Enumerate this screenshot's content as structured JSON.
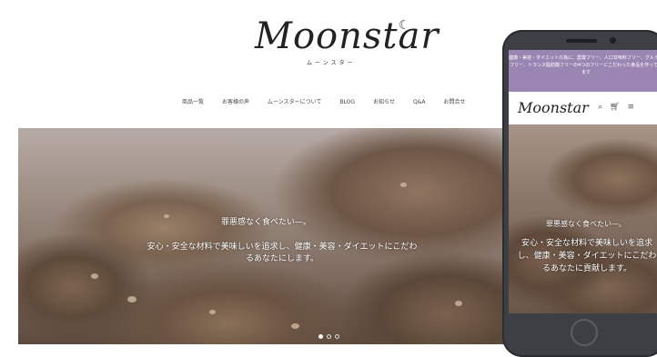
{
  "brand": {
    "logo_text": "Moonstar",
    "logo_kana": "ムーンスター"
  },
  "nav": {
    "items": [
      {
        "label": "商品一覧"
      },
      {
        "label": "お客様の声"
      },
      {
        "label": "ムーンスターについて"
      },
      {
        "label": "BLOG"
      },
      {
        "label": "お知らせ"
      },
      {
        "label": "Q&A"
      },
      {
        "label": "お問合せ"
      }
    ]
  },
  "hero": {
    "title": "罪悪感なく食べたい—。",
    "body": "安心・安全な材料で美味しいを追求し、健康・美容・ダイエットにこだわるあなたにします。"
  },
  "slider": {
    "count": 3,
    "active": 1
  },
  "phone": {
    "banner": "健康・美容・ダイエットの為に、農薬フリー、人口甘味料フリー、グルテンフリー、トランス脂肪酸フリーの4つのフリーにこだわった食品を作っています",
    "logo_text": "Moonstar",
    "hero_title": "罪悪感なく食べたい—。",
    "hero_body": "安心・安全な材料で美味しいを追求し、健康・美容・ダイエットにこだわるあなたに貢献します。"
  },
  "colors": {
    "banner": "#9b86b3",
    "phone_frame": "#3c3f44"
  }
}
